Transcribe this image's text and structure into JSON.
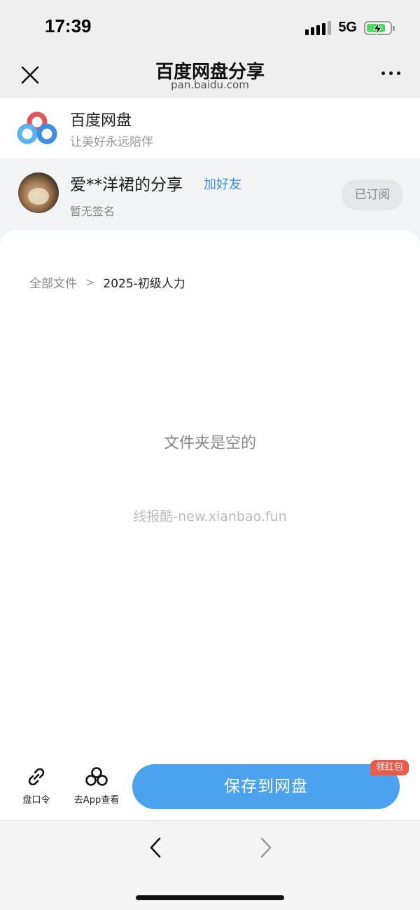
{
  "status_bar": {
    "time": "17:39",
    "network": "5G",
    "icons": [
      "signal-icon",
      "battery-charging-icon"
    ]
  },
  "nav": {
    "title": "百度网盘分享",
    "subtitle": "pan.baidu.com",
    "close_icon": "close-icon",
    "more_icon": "more-icon"
  },
  "app_banner": {
    "name": "百度网盘",
    "slogan": "让美好永远陪伴",
    "logo_icon": "baidu-netdisk-logo"
  },
  "sharer": {
    "name": "爱**洋裙的分享",
    "add_friend_label": "加好友",
    "signature": "暂无签名",
    "subscribe_label": "已订阅"
  },
  "breadcrumb": {
    "root": "全部文件",
    "separator": ">",
    "current": "2025-初级人力"
  },
  "main": {
    "empty_message": "文件夹是空的",
    "watermark": "线报酷-new.xianbao.fun"
  },
  "actions": {
    "share_code_label": "盘口令",
    "open_app_label": "去App查看",
    "save_label": "保存到网盘",
    "badge_label": "领红包"
  },
  "colors": {
    "accent": "#4ba3f0",
    "link": "#3b8fe0",
    "badge": "#ee5a4a"
  }
}
